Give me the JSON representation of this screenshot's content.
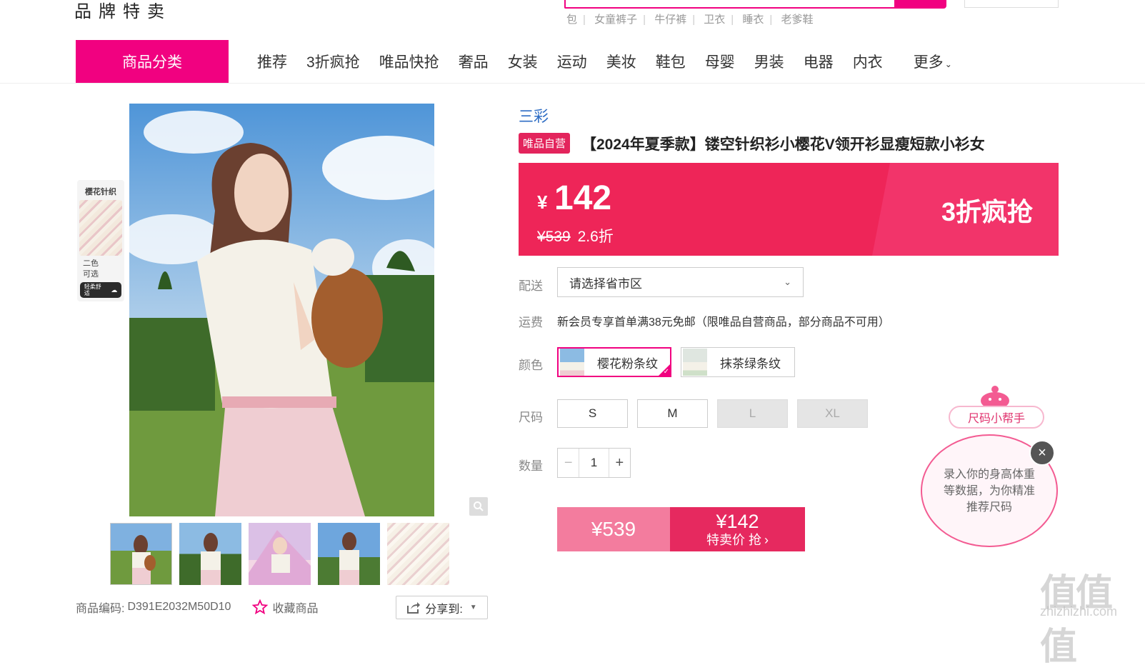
{
  "header": {
    "brand_text": "品牌特卖",
    "hot_words": [
      "包",
      "女童裤子",
      "牛仔裤",
      "卫衣",
      "睡衣",
      "老爹鞋"
    ]
  },
  "nav": {
    "category_button": "商品分类",
    "items": [
      "推荐",
      "3折疯抢",
      "唯品快抢",
      "奢品",
      "女装",
      "运动",
      "美妆",
      "鞋包",
      "母婴",
      "男装",
      "电器",
      "内衣"
    ],
    "more": "更多"
  },
  "gallery": {
    "tag_card": {
      "title": "樱花针织",
      "line1": "二色",
      "line2": "可选",
      "line3": "轻柔舒适"
    },
    "thumb_count": 5
  },
  "bottom_bar": {
    "code_label": "商品编码:",
    "code_value": "D391E2032M50D10",
    "favorite": "收藏商品",
    "share": "分享到:"
  },
  "product": {
    "brand": "三彩",
    "self_badge": "唯品自营",
    "title": "【2024年夏季款】镂空针织衫小樱花V领开衫显瘦短款小衫女",
    "currency": "¥",
    "price": "142",
    "original_price": "¥539",
    "discount": "2.6折",
    "promo_label": "3折疯抢"
  },
  "delivery": {
    "label": "配送",
    "select_value": "请选择省市区"
  },
  "shipping": {
    "label": "运费",
    "text": "新会员专享首单满38元免邮（限唯品自营商品，部分商品不可用）"
  },
  "color": {
    "label": "颜色",
    "options": [
      "樱花粉条纹",
      "抹茶绿条纹"
    ],
    "selected": "樱花粉条纹"
  },
  "size": {
    "label": "尺码",
    "options": [
      "S",
      "M",
      "L",
      "XL"
    ],
    "disabled": [
      "L",
      "XL"
    ]
  },
  "quantity": {
    "label": "数量",
    "value": "1",
    "minus": "−",
    "plus": "+"
  },
  "buy": {
    "original_price": "¥539",
    "special_price": "¥142",
    "action_text": "特卖价 抢"
  },
  "size_helper": {
    "title": "尺码小帮手",
    "message": "录入你的身高体重等数据，为你精准推荐尺码"
  },
  "watermark": {
    "main": "值值值",
    "sub": "zhizhizhi.com"
  },
  "colors": {
    "brand_pink": "#f10180",
    "price_band": "#ee2558",
    "link_blue": "#2d6cc4"
  }
}
